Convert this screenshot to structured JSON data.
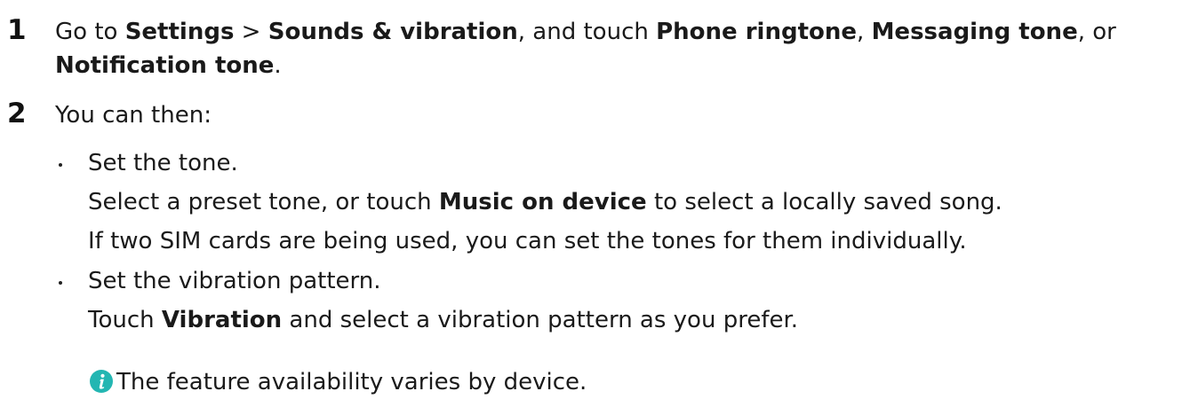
{
  "steps": [
    {
      "number": "1",
      "line1": {
        "t1": "Go to ",
        "b1": "Settings",
        "t2": " > ",
        "b2": "Sounds & vibration",
        "t3": ", and touch ",
        "b3": "Phone ringtone",
        "t4": ", ",
        "b4": "Messaging tone",
        "t5": ", or"
      },
      "line2": {
        "b1": "Notification tone",
        "t1": "."
      }
    },
    {
      "number": "2",
      "text": "You can then:"
    }
  ],
  "bullets": [
    {
      "title": "Set the tone.",
      "detail1": {
        "t1": "Select a preset tone, or touch ",
        "b1": "Music on device",
        "t2": " to select a locally saved song."
      },
      "detail2": "If two SIM cards are being used, you can set the tones for them individually."
    },
    {
      "title": "Set the vibration pattern.",
      "detail1": {
        "t1": "Touch ",
        "b1": "Vibration",
        "t2": " and select a vibration pattern as you prefer."
      }
    }
  ],
  "note": {
    "icon": "info-icon",
    "icon_color": "#23b6b2",
    "text": "The feature availability varies by device."
  }
}
